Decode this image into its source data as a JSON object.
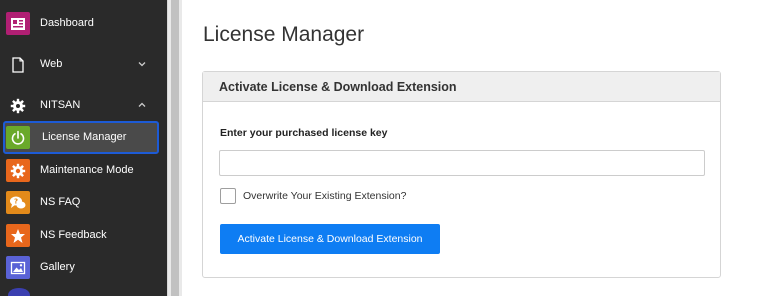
{
  "page": {
    "title": "License Manager"
  },
  "sidebar": {
    "items": [
      {
        "label": "Dashboard",
        "icon": "dashboard-icon",
        "icon_bg": "#b01f73"
      },
      {
        "label": "Web",
        "icon": "document-icon",
        "has_chevron": true
      },
      {
        "label": "NITSAN",
        "icon": "gear-icon",
        "has_chevron": true
      },
      {
        "label": "License Manager",
        "icon": "power-icon",
        "icon_bg": "#6aa92a",
        "active": true
      },
      {
        "label": "Maintenance Mode",
        "icon": "maintenance-gear-icon",
        "icon_bg": "#e8671c"
      },
      {
        "label": "NS FAQ",
        "icon": "faq-icon",
        "icon_bg": "#e38a1a"
      },
      {
        "label": "NS Feedback",
        "icon": "star-icon",
        "icon_bg": "#e8671c"
      },
      {
        "label": "Gallery",
        "icon": "gallery-icon",
        "icon_bg": "#5a62d6"
      }
    ]
  },
  "panel": {
    "header": "Activate License & Download Extension",
    "field_label": "Enter your purchased license key",
    "input": {
      "value": "",
      "placeholder": ""
    },
    "checkbox_label": "Overwrite Your Existing Extension?",
    "checkbox_checked": false,
    "button_label": "Activate License & Download Extension"
  },
  "colors": {
    "sidebar_bg": "#2a2a2a",
    "active_border": "#1d5bd6",
    "primary_button": "#0e7df3"
  }
}
